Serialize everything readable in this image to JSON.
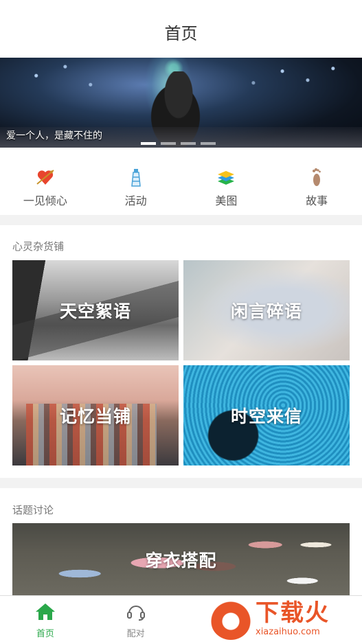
{
  "header": {
    "title": "首页"
  },
  "banner": {
    "caption": "爱一个人，是藏不住的",
    "dots_count": 4,
    "active_dot": 1
  },
  "quick_nav": [
    {
      "label": "一见倾心",
      "icon": "heart-arrow-icon"
    },
    {
      "label": "活动",
      "icon": "lighthouse-icon"
    },
    {
      "label": "美图",
      "icon": "layers-icon"
    },
    {
      "label": "故事",
      "icon": "footprint-icon"
    }
  ],
  "store": {
    "title": "心灵杂货铺",
    "tiles": [
      {
        "label": "天空絮语"
      },
      {
        "label": "闲言碎语"
      },
      {
        "label": "记忆当铺"
      },
      {
        "label": "时空来信"
      }
    ]
  },
  "topics": {
    "title": "话题讨论",
    "featured": {
      "label": "穿衣搭配"
    }
  },
  "tabbar": {
    "tabs": [
      {
        "label": "首页",
        "icon": "home-icon",
        "active": true
      },
      {
        "label": "配对",
        "icon": "headset-icon",
        "active": false
      }
    ]
  },
  "watermark": {
    "brand": "下载火",
    "url": "xiazaihuo.com"
  },
  "colors": {
    "accent": "#2aa84a",
    "watermark": "#e95528"
  }
}
